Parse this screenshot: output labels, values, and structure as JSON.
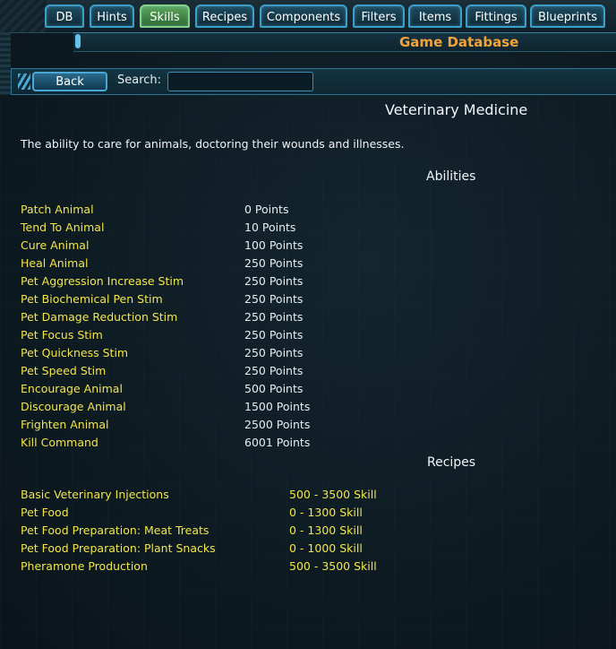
{
  "nav": {
    "tabs": [
      {
        "label": "DB"
      },
      {
        "label": "Hints"
      },
      {
        "label": "Skills",
        "active": true
      },
      {
        "label": "Recipes"
      },
      {
        "label": "Components"
      },
      {
        "label": "Filters"
      },
      {
        "label": "Items"
      },
      {
        "label": "Fittings"
      },
      {
        "label": "Blueprints"
      }
    ]
  },
  "header": {
    "title": "Game Database"
  },
  "toolbar": {
    "back_label": "Back",
    "search_label": "Search:",
    "search_value": ""
  },
  "skill": {
    "name": "Veterinary Medicine",
    "description": "The ability to care for animals, doctoring their wounds and illnesses."
  },
  "abilities": {
    "heading": "Abilities",
    "items": [
      {
        "name": "Patch Animal",
        "value": "0 Points"
      },
      {
        "name": "Tend To Animal",
        "value": "10 Points"
      },
      {
        "name": "Cure Animal",
        "value": "100 Points"
      },
      {
        "name": "Heal Animal",
        "value": "250 Points"
      },
      {
        "name": "Pet Aggression Increase Stim",
        "value": "250 Points"
      },
      {
        "name": "Pet Biochemical Pen Stim",
        "value": "250 Points"
      },
      {
        "name": "Pet Damage Reduction Stim",
        "value": "250 Points"
      },
      {
        "name": "Pet Focus Stim",
        "value": "250 Points"
      },
      {
        "name": "Pet Quickness Stim",
        "value": "250 Points"
      },
      {
        "name": "Pet Speed Stim",
        "value": "250 Points"
      },
      {
        "name": "Encourage Animal",
        "value": "500 Points"
      },
      {
        "name": "Discourage Animal",
        "value": "1500 Points"
      },
      {
        "name": "Frighten Animal",
        "value": "2500 Points"
      },
      {
        "name": "Kill Command",
        "value": "6001 Points"
      }
    ]
  },
  "recipes": {
    "heading": "Recipes",
    "items": [
      {
        "name": "Basic Veterinary Injections",
        "value": "500 - 3500 Skill"
      },
      {
        "name": "Pet Food",
        "value": "0 - 1300 Skill"
      },
      {
        "name": "Pet Food Preparation: Meat Treats",
        "value": "0 - 1300 Skill"
      },
      {
        "name": "Pet Food Preparation: Plant Snacks",
        "value": "0 - 1000 Skill"
      },
      {
        "name": "Pheramone Production",
        "value": "500 - 3500 Skill"
      }
    ]
  },
  "colors": {
    "accent_title": "#f0a43a",
    "link_yellow": "#f2e64a",
    "tab_border": "#3aa0c8",
    "tab_active": "#5da65d"
  }
}
